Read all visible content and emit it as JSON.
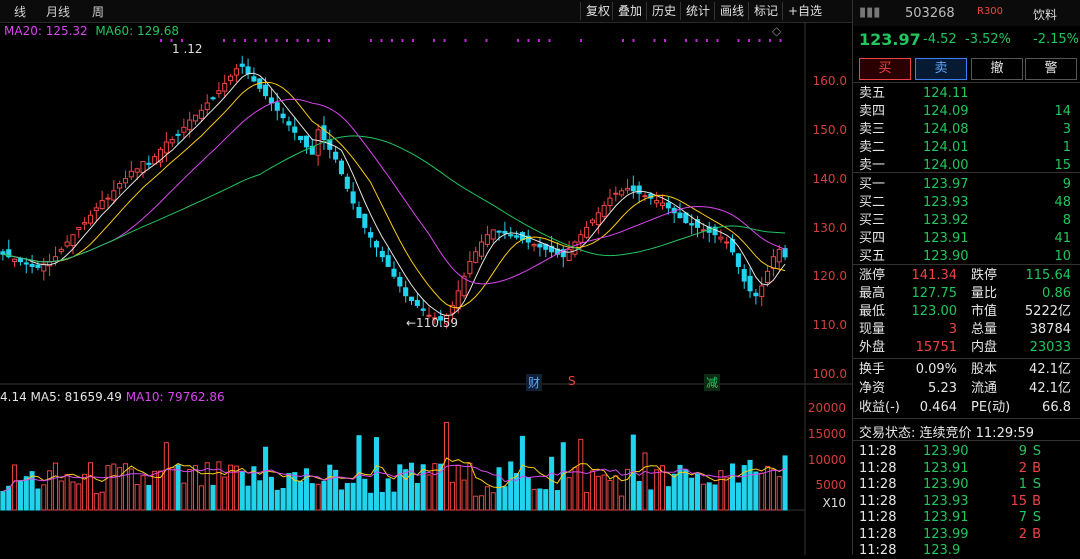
{
  "toolbar": {
    "period_left": "线",
    "monthly": "月线",
    "partial": "周",
    "buttons": [
      "复权",
      "叠加",
      "历史",
      "统计",
      "画线",
      "标记",
      "+自选"
    ]
  },
  "ma_legend": {
    "ma20": "MA20: 125.32",
    "ma60": "MA60: 129.68"
  },
  "annotations": {
    "high_label": "1  .12",
    "low_label": "←110.59",
    "event_cai": "财",
    "event_s": "S",
    "event_jian": "减"
  },
  "price_axis": [
    "160.0",
    "150.0",
    "140.0",
    "130.0",
    "120.0",
    "110.0",
    "100.0"
  ],
  "volume_legend": {
    "prefix": "4.14",
    "ma5": "MA5: 81659.49",
    "ma10": "MA10: 79762.86"
  },
  "volume_axis": [
    "20000",
    "15000",
    "10000",
    "5000",
    "X10"
  ],
  "colors": {
    "up": "#ef4444",
    "down": "#22d3ee",
    "ma5": "#e5e5e5",
    "ma10": "#facc15",
    "ma20": "#d946ef",
    "ma60": "#22c55e"
  },
  "header": {
    "code": "503268",
    "tag": "R300",
    "name_right": "饮料",
    "price": "123.97",
    "change": "-4.52",
    "change_pct": "-3.52%",
    "index_pct": "-2.15%"
  },
  "buttons": {
    "buy": "买",
    "sell": "卖",
    "cancel": "撤",
    "alert": "警"
  },
  "asks": [
    {
      "label": "卖五",
      "price": "124.11",
      "vol": ""
    },
    {
      "label": "卖四",
      "price": "124.09",
      "vol": "14"
    },
    {
      "label": "卖三",
      "price": "124.08",
      "vol": "3"
    },
    {
      "label": "卖二",
      "price": "124.01",
      "vol": "1"
    },
    {
      "label": "卖一",
      "price": "124.00",
      "vol": "15"
    }
  ],
  "bids": [
    {
      "label": "买一",
      "price": "123.97",
      "vol": "9"
    },
    {
      "label": "买二",
      "price": "123.93",
      "vol": "48"
    },
    {
      "label": "买三",
      "price": "123.92",
      "vol": "8"
    },
    {
      "label": "买四",
      "price": "123.91",
      "vol": "41"
    },
    {
      "label": "买五",
      "price": "123.90",
      "vol": "10"
    }
  ],
  "stats": [
    {
      "k1": "涨停",
      "v1": "141.34",
      "c1": "red",
      "k2": "跌停",
      "v2": "115.64",
      "c2": "green"
    },
    {
      "k1": "最高",
      "v1": "127.75",
      "c1": "green",
      "k2": "量比",
      "v2": "0.86",
      "c2": "green"
    },
    {
      "k1": "最低",
      "v1": "123.00",
      "c1": "green",
      "k2": "市值",
      "v2": "5222亿",
      "c2": "white"
    },
    {
      "k1": "现量",
      "v1": "3",
      "c1": "red",
      "k2": "总量",
      "v2": "38784",
      "c2": "white"
    },
    {
      "k1": "外盘",
      "v1": "15751",
      "c1": "red",
      "k2": "内盘",
      "v2": "23033",
      "c2": "green"
    }
  ],
  "stats2": [
    {
      "k1": "换手",
      "v1": "0.09%",
      "k2": "股本",
      "v2": "42.1亿"
    },
    {
      "k1": "净资",
      "v1": "5.23",
      "k2": "流通",
      "v2": "42.1亿"
    },
    {
      "k1": "收益(-)",
      "v1": "0.464",
      "k2": "PE(动)",
      "v2": "66.8"
    }
  ],
  "trade_status": "交易状态: 连续竞价 11:29:59",
  "trades": [
    {
      "time": "11:28",
      "price": "123.90",
      "vol": "9",
      "side": "S"
    },
    {
      "time": "11:28",
      "price": "123.91",
      "vol": "2",
      "side": "B"
    },
    {
      "time": "11:28",
      "price": "123.90",
      "vol": "1",
      "side": "S"
    },
    {
      "time": "11:28",
      "price": "123.93",
      "vol": "15",
      "side": "B"
    },
    {
      "time": "11:28",
      "price": "123.91",
      "vol": "7",
      "side": "S"
    },
    {
      "time": "11:28",
      "price": "123.99",
      "vol": "2",
      "side": "B"
    },
    {
      "time": "11:28",
      "price": "123.9",
      "vol": "",
      "side": ""
    }
  ],
  "chart_data": {
    "type": "candlestick",
    "ylim": [
      100,
      170
    ],
    "annotated_high": 166.12,
    "annotated_low": 110.59,
    "closes": [
      124.5,
      124,
      123.5,
      123,
      122.5,
      122,
      121.8,
      122.5,
      123,
      124,
      125.5,
      127,
      128.5,
      130,
      131,
      132.5,
      134,
      135.5,
      136,
      137.5,
      139,
      140,
      141.5,
      142,
      143.5,
      143,
      144.5,
      146,
      147.5,
      148,
      149,
      150.5,
      152,
      153,
      154,
      155.5,
      156.5,
      158,
      159.5,
      161,
      162.5,
      163,
      161.5,
      160,
      158.5,
      157,
      155.5,
      154,
      152.5,
      151,
      149.5,
      148,
      146.5,
      145,
      150,
      148,
      146,
      144,
      141,
      138,
      135,
      132,
      130,
      128,
      126,
      124,
      122,
      120,
      118,
      116,
      115,
      114,
      113,
      112,
      111.5,
      111,
      112,
      114,
      117,
      120,
      123,
      125,
      127,
      128.5,
      129.5,
      129.2,
      128.8,
      128.4,
      128,
      127.5,
      127,
      126.5,
      126,
      125.5,
      125,
      124.5,
      124,
      125.5,
      127,
      128.5,
      130,
      131.5,
      133,
      134.5,
      136,
      137,
      137.5,
      138,
      137.5,
      137,
      136.5,
      136,
      135.5,
      135,
      134,
      133,
      132,
      131,
      130.5,
      130,
      129.5,
      129,
      128.5,
      128,
      127,
      125,
      122,
      119,
      117,
      116,
      118,
      121,
      124,
      125.5,
      123.97
    ]
  }
}
